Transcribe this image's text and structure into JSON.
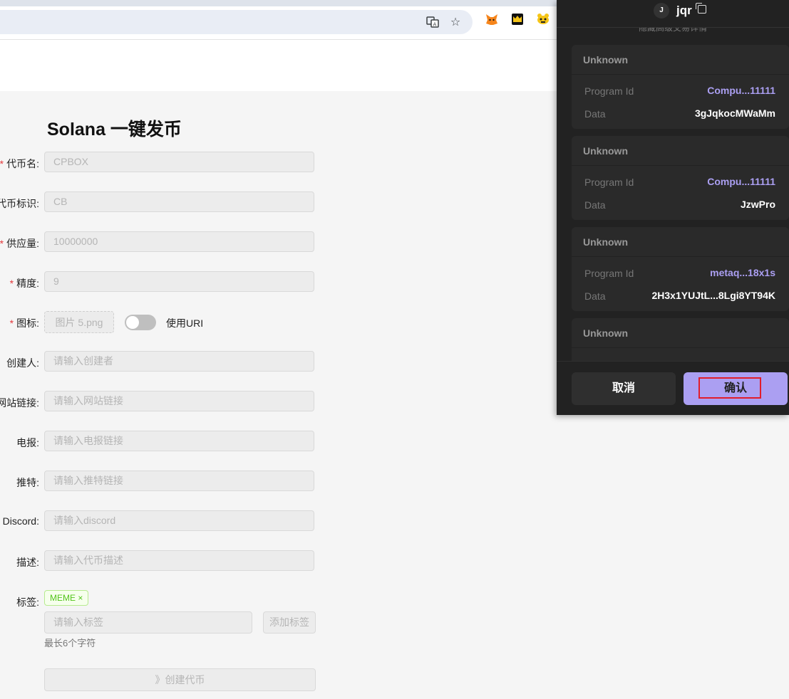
{
  "browser": {
    "ext_colors": {
      "fox": "#f6851b",
      "crown": "#f5c518",
      "bear": "#333333"
    }
  },
  "form": {
    "title": "Solana 一键发币",
    "fields": [
      {
        "label": "代币名:",
        "required": true,
        "value": "CPBOX"
      },
      {
        "label": "代币标识:",
        "required": false,
        "value": "CB"
      },
      {
        "label": "供应量:",
        "required": true,
        "value": "10000000"
      },
      {
        "label": "精度:",
        "required": true,
        "value": "9"
      },
      {
        "label": "图标:",
        "required": true,
        "value": "图片 5.png"
      },
      {
        "label": "创建人:",
        "required": false,
        "value": "请输入创建者"
      },
      {
        "label": "网站链接:",
        "required": false,
        "value": "请输入网站链接"
      },
      {
        "label": "电报:",
        "required": false,
        "value": "请输入电报链接"
      },
      {
        "label": "推特:",
        "required": false,
        "value": "请输入推特链接"
      },
      {
        "label": "Discord:",
        "required": false,
        "value": "请输入discord"
      },
      {
        "label": "描述:",
        "required": false,
        "value": "请输入代币描述"
      },
      {
        "label": "标签:",
        "required": false,
        "value": ""
      }
    ],
    "req_mark": "*",
    "switch_label": "使用URI",
    "tag_chip": "MEME ×",
    "tag_input_placeholder": "请输入标签",
    "tag_add_button": "添加标签",
    "hint": "最长6个字符",
    "submit": "》创建代币"
  },
  "wallet": {
    "avatar_letter": "J",
    "account": "jqr",
    "subtitle": "隐藏高级交易详情",
    "cards": [
      {
        "title": "Unknown",
        "program_id_label": "Program Id",
        "program_id": "Compu...11111",
        "data_label": "Data",
        "data": "3gJqkocMWaMm"
      },
      {
        "title": "Unknown",
        "program_id_label": "Program Id",
        "program_id": "Compu...11111",
        "data_label": "Data",
        "data": "JzwPro"
      },
      {
        "title": "Unknown",
        "program_id_label": "Program Id",
        "program_id": "metaq...18x1s",
        "data_label": "Data",
        "data": "2H3x1YUJtL...8Lgi8YT94K"
      },
      {
        "title": "Unknown"
      }
    ],
    "cancel": "取消",
    "confirm": "确认",
    "colors": {
      "bg": "#222222",
      "accent": "#ab9ff2",
      "highlight": "#e11d2b"
    }
  }
}
